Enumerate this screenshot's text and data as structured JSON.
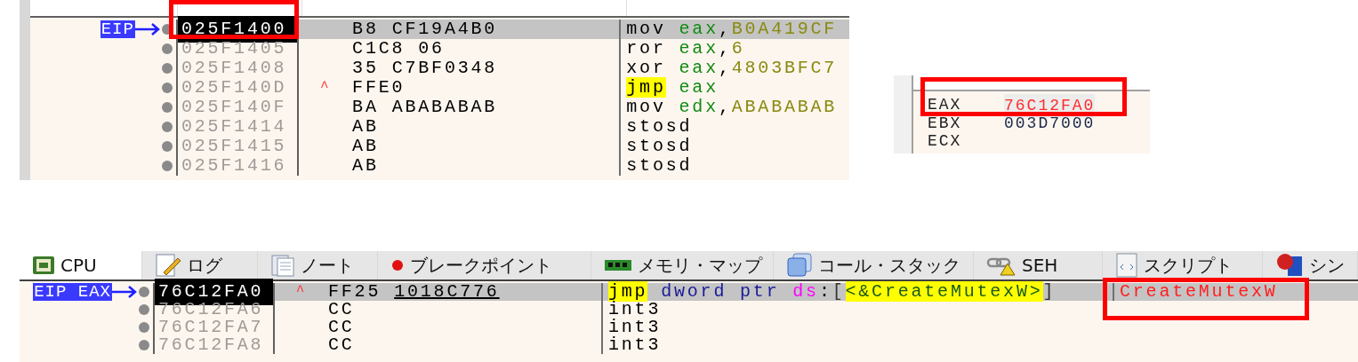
{
  "top_disassembly": {
    "gutter_label": "EIP",
    "rows": [
      {
        "address": "025F1400",
        "selected": true,
        "jump_marker": "",
        "bytes": [
          {
            "text": "B8",
            "underlined": false
          },
          {
            "text": "CF19A4B0",
            "underlined": false
          }
        ],
        "instruction": [
          {
            "parts": [
              {
                "kind": "mnemonic",
                "text": "mov"
              }
            ]
          },
          {
            "parts": [
              {
                "kind": "register",
                "text": "eax"
              },
              {
                "kind": "punct",
                "text": ","
              },
              {
                "kind": "number",
                "text": "B0A419CF"
              }
            ]
          }
        ]
      },
      {
        "address": "025F1405",
        "selected": false,
        "jump_marker": "",
        "bytes": [
          {
            "text": "C1C8",
            "underlined": false
          },
          {
            "text": "06",
            "underlined": false
          }
        ],
        "instruction": [
          {
            "parts": [
              {
                "kind": "mnemonic",
                "text": "ror"
              }
            ]
          },
          {
            "parts": [
              {
                "kind": "register",
                "text": "eax"
              },
              {
                "kind": "punct",
                "text": ","
              },
              {
                "kind": "number",
                "text": "6"
              }
            ]
          }
        ]
      },
      {
        "address": "025F1408",
        "selected": false,
        "jump_marker": "",
        "bytes": [
          {
            "text": "35",
            "underlined": false
          },
          {
            "text": "C7BF0348",
            "underlined": false
          }
        ],
        "instruction": [
          {
            "parts": [
              {
                "kind": "mnemonic",
                "text": "xor"
              }
            ]
          },
          {
            "parts": [
              {
                "kind": "register",
                "text": "eax"
              },
              {
                "kind": "punct",
                "text": ","
              },
              {
                "kind": "number",
                "text": "4803BFC7"
              }
            ]
          }
        ]
      },
      {
        "address": "025F140D",
        "selected": false,
        "jump_marker": "^",
        "bytes": [
          {
            "text": "FFE0",
            "underlined": false
          }
        ],
        "instruction": [
          {
            "parts": [
              {
                "kind": "jump",
                "text": "jmp"
              }
            ]
          },
          {
            "parts": [
              {
                "kind": "register",
                "text": "eax"
              }
            ]
          }
        ]
      },
      {
        "address": "025F140F",
        "selected": false,
        "jump_marker": "",
        "bytes": [
          {
            "text": "BA",
            "underlined": false
          },
          {
            "text": "ABABABAB",
            "underlined": false
          }
        ],
        "instruction": [
          {
            "parts": [
              {
                "kind": "mnemonic",
                "text": "mov"
              }
            ]
          },
          {
            "parts": [
              {
                "kind": "register",
                "text": "edx"
              },
              {
                "kind": "punct",
                "text": ","
              },
              {
                "kind": "number",
                "text": "ABABABAB"
              }
            ]
          }
        ]
      },
      {
        "address": "025F1414",
        "selected": false,
        "jump_marker": "",
        "bytes": [
          {
            "text": "AB",
            "underlined": false
          }
        ],
        "instruction": [
          {
            "parts": [
              {
                "kind": "mnemonic",
                "text": "stosd"
              }
            ]
          }
        ]
      },
      {
        "address": "025F1415",
        "selected": false,
        "jump_marker": "",
        "bytes": [
          {
            "text": "AB",
            "underlined": false
          }
        ],
        "instruction": [
          {
            "parts": [
              {
                "kind": "mnemonic",
                "text": "stosd"
              }
            ]
          }
        ]
      },
      {
        "address": "025F1416",
        "selected": false,
        "jump_marker": "",
        "bytes": [
          {
            "text": "AB",
            "underlined": false
          }
        ],
        "instruction": [
          {
            "parts": [
              {
                "kind": "mnemonic",
                "text": "stosd"
              }
            ]
          }
        ]
      }
    ]
  },
  "registers": [
    {
      "name": "EAX",
      "value": "76C12FA0",
      "selected": true,
      "changed": true
    },
    {
      "name": "EBX",
      "value": "003D7000",
      "selected": false,
      "changed": false
    },
    {
      "name": "ECX",
      "selected": false
    }
  ],
  "tabs": [
    {
      "label": "CPU",
      "selected": true
    },
    {
      "label": "ログ",
      "selected": false
    },
    {
      "label": "ノート",
      "selected": false
    },
    {
      "label": "ブレークポイント",
      "selected": false
    },
    {
      "label": "メモリ・マップ",
      "selected": false
    },
    {
      "label": "コール・スタック",
      "selected": false
    },
    {
      "label": "SEH",
      "selected": false
    },
    {
      "label": "スクリプト",
      "selected": false
    },
    {
      "label": "シン",
      "selected": false
    }
  ],
  "bottom_disassembly": {
    "gutter_label": "EIP EAX",
    "rows": [
      {
        "address": "76C12FA0",
        "selected": true,
        "jump_marker": "^",
        "bytes": [
          {
            "text": "FF25",
            "underlined": false
          },
          {
            "text": "1018C776",
            "underlined": true
          }
        ],
        "instruction": [
          {
            "parts": [
              {
                "kind": "jump",
                "text": "jmp"
              }
            ]
          },
          {
            "parts": [
              {
                "kind": "ptr",
                "text": "dword"
              }
            ]
          },
          {
            "parts": [
              {
                "kind": "ptr",
                "text": "ptr"
              }
            ]
          },
          {
            "parts": [
              {
                "kind": "segment",
                "text": "ds"
              },
              {
                "kind": "punct",
                "text": ":"
              },
              {
                "kind": "bracket",
                "text": "["
              },
              {
                "kind": "symbol",
                "text": "<&CreateMutexW>"
              },
              {
                "kind": "bracket",
                "text": "]"
              }
            ]
          }
        ],
        "comment": "CreateMutexW"
      },
      {
        "address": "76C12FA6",
        "selected": false,
        "jump_marker": "",
        "bytes": [
          {
            "text": "CC",
            "underlined": false
          }
        ],
        "instruction": [
          {
            "parts": [
              {
                "kind": "mnemonic",
                "text": "int3"
              }
            ]
          }
        ]
      },
      {
        "address": "76C12FA7",
        "selected": false,
        "jump_marker": "",
        "bytes": [
          {
            "text": "CC",
            "underlined": false
          }
        ],
        "instruction": [
          {
            "parts": [
              {
                "kind": "mnemonic",
                "text": "int3"
              }
            ]
          }
        ]
      },
      {
        "address": "76C12FA8",
        "selected": false,
        "jump_marker": "",
        "bytes": [
          {
            "text": "CC",
            "underlined": false
          }
        ],
        "instruction": [
          {
            "parts": [
              {
                "kind": "mnemonic",
                "text": "int3"
              }
            ]
          }
        ]
      }
    ]
  }
}
